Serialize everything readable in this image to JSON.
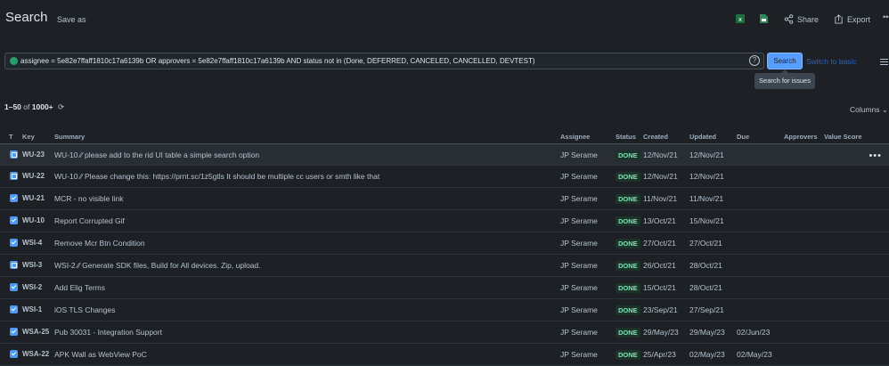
{
  "header": {
    "title": "Search",
    "save_as": "Save as",
    "share": "Share",
    "export": "Export",
    "more": "•••"
  },
  "query": {
    "text": "assignee = 5e82e7ffaff1810c17a6139b OR approvers = 5e82e7ffaff1810c17a6139b AND status not in (Done, DEFERRED, CANCELED, CANCELLED, DEVTEST)",
    "help": "?"
  },
  "search_button": "Search",
  "switch_link": "Switch to basic",
  "tooltip": "Search for issues",
  "results": {
    "range": "1–50",
    "of": "of",
    "total": "1000+"
  },
  "columns_button": "Columns",
  "table": {
    "headers": {
      "t": "T",
      "key": "Key",
      "summary": "Summary",
      "assignee": "Assignee",
      "status": "Status",
      "created": "Created",
      "updated": "Updated",
      "due": "Due",
      "approvers": "Approvers",
      "value_score": "Value Score"
    },
    "rows": [
      {
        "type": "subtask",
        "key": "WU-23",
        "summary": "WU-10 ⁄⁄ please add to the rid UI table a simple search option",
        "assignee": "JP Serame",
        "status": "DONE",
        "created": "12/Nov/21",
        "updated": "12/Nov/21",
        "due": ""
      },
      {
        "type": "subtask",
        "key": "WU-22",
        "summary": "WU-10 ⁄⁄ Please change this: https://prnt.sc/1z5gtls It should be multiple cc users or smth like that",
        "assignee": "JP Serame",
        "status": "DONE",
        "created": "12/Nov/21",
        "updated": "12/Nov/21",
        "due": ""
      },
      {
        "type": "task",
        "key": "WU-21",
        "summary": "MCR - no visible link",
        "assignee": "JP Serame",
        "status": "DONE",
        "created": "11/Nov/21",
        "updated": "11/Nov/21",
        "due": ""
      },
      {
        "type": "task",
        "key": "WU-10",
        "summary": "Report Corrupted Gif",
        "assignee": "JP Serame",
        "status": "DONE",
        "created": "13/Oct/21",
        "updated": "15/Nov/21",
        "due": ""
      },
      {
        "type": "task",
        "key": "WSI-4",
        "summary": "Remove Mcr Btn Condition",
        "assignee": "JP Serame",
        "status": "DONE",
        "created": "27/Oct/21",
        "updated": "27/Oct/21",
        "due": ""
      },
      {
        "type": "subtask",
        "key": "WSI-3",
        "summary": "WSI-2 ⁄⁄ Generate SDK files, Build for All devices. Zip, upload.",
        "assignee": "JP Serame",
        "status": "DONE",
        "created": "26/Oct/21",
        "updated": "28/Oct/21",
        "due": ""
      },
      {
        "type": "task",
        "key": "WSI-2",
        "summary": "Add Elig Terms",
        "assignee": "JP Serame",
        "status": "DONE",
        "created": "15/Oct/21",
        "updated": "28/Oct/21",
        "due": ""
      },
      {
        "type": "task",
        "key": "WSI-1",
        "summary": "iOS TLS Changes",
        "assignee": "JP Serame",
        "status": "DONE",
        "created": "23/Sep/21",
        "updated": "27/Sep/21",
        "due": ""
      },
      {
        "type": "task",
        "key": "WSA-25",
        "summary": "Pub 30031 - Integration Support",
        "assignee": "JP Serame",
        "status": "DONE",
        "created": "29/May/23",
        "updated": "29/May/23",
        "due": "02/Jun/23"
      },
      {
        "type": "task",
        "key": "WSA-22",
        "summary": "APK Wall as WebView PoC",
        "assignee": "JP Serame",
        "status": "DONE",
        "created": "25/Apr/23",
        "updated": "02/May/23",
        "due": "02/May/23"
      }
    ]
  },
  "colors": {
    "background": "#1d2125",
    "accent": "#579dff",
    "done_bg": "#1c3329",
    "done_text": "#7ee2b8"
  }
}
